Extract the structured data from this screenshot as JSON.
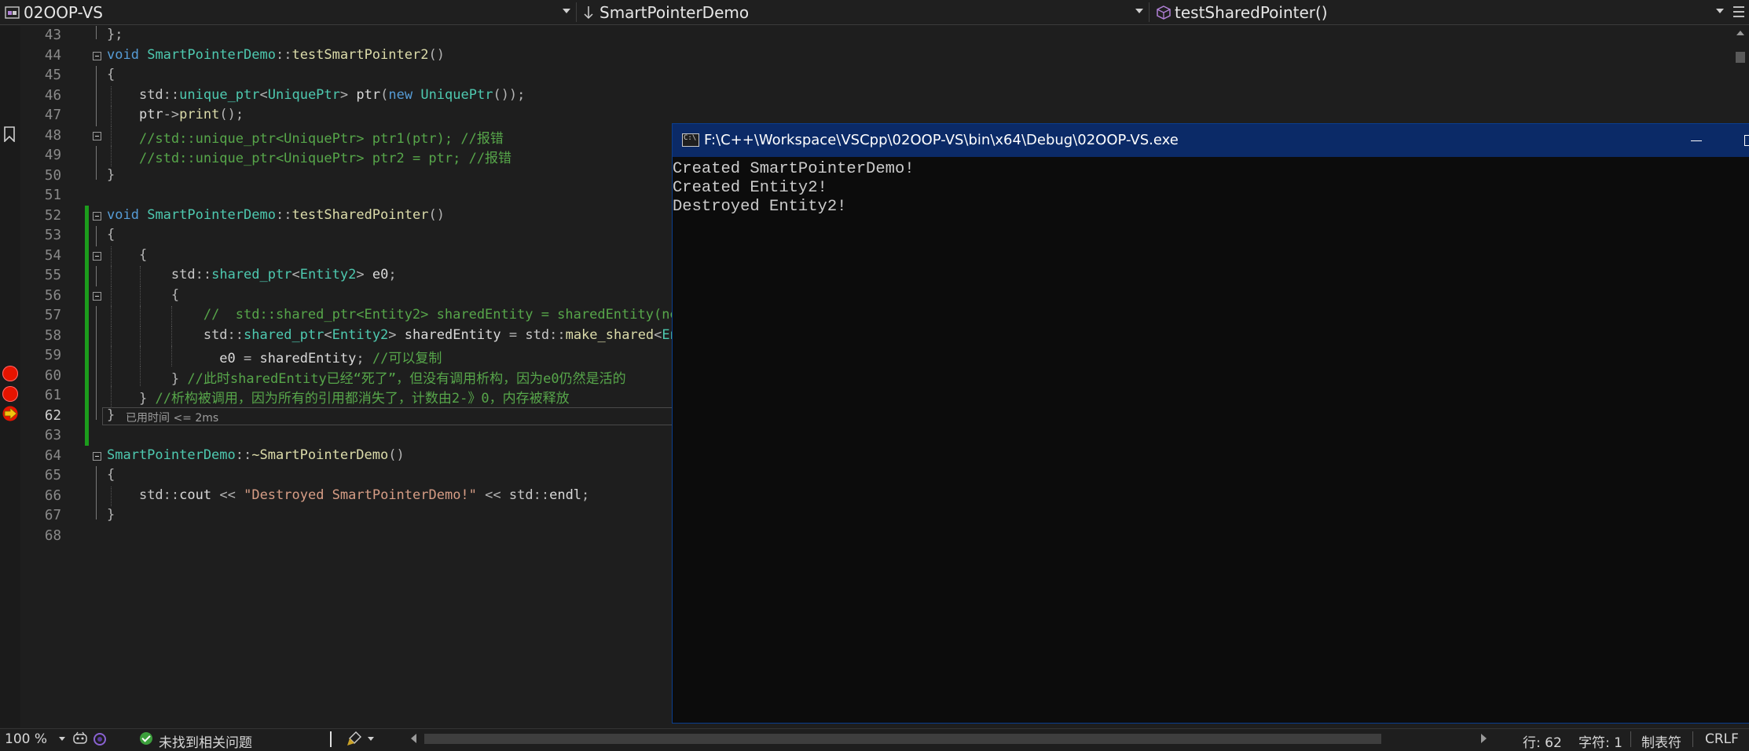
{
  "navbar": {
    "project": "02OOP-VS",
    "scope": "SmartPointerDemo",
    "member": "testSharedPointer()"
  },
  "editor": {
    "lines": [
      {
        "n": "43"
      },
      {
        "n": "44"
      },
      {
        "n": "45"
      },
      {
        "n": "46"
      },
      {
        "n": "47"
      },
      {
        "n": "48"
      },
      {
        "n": "49"
      },
      {
        "n": "50"
      },
      {
        "n": "51"
      },
      {
        "n": "52"
      },
      {
        "n": "53"
      },
      {
        "n": "54"
      },
      {
        "n": "55"
      },
      {
        "n": "56"
      },
      {
        "n": "57"
      },
      {
        "n": "58"
      },
      {
        "n": "59"
      },
      {
        "n": "60"
      },
      {
        "n": "61"
      },
      {
        "n": "62"
      },
      {
        "n": "63"
      },
      {
        "n": "64"
      },
      {
        "n": "65"
      },
      {
        "n": "66"
      },
      {
        "n": "67"
      },
      {
        "n": "68"
      }
    ],
    "timing": "已用时间 <= 2ms",
    "current_line": "62"
  },
  "console": {
    "title": "F:\\C++\\Workspace\\VSCpp\\02OOP-VS\\bin\\x64\\Debug\\02OOP-VS.exe",
    "icon_text": "C:\\",
    "output": [
      "Created SmartPointerDemo!",
      "Created Entity2!",
      "Destroyed Entity2!"
    ]
  },
  "statusbar": {
    "zoom": "100 %",
    "issues": "未找到相关问题",
    "line": "行: 62",
    "char": "字符: 1",
    "tabs": "制表符",
    "eol": "CRLF"
  },
  "colors": {
    "keyword": "#569cd6",
    "type": "#4ec9b0",
    "function": "#dcdcaa",
    "comment": "#57a64a",
    "string": "#d69d85",
    "console_title_bar": "#0b2a67",
    "breakpoint": "#e51400",
    "change_bar": "#1c9c1c"
  }
}
